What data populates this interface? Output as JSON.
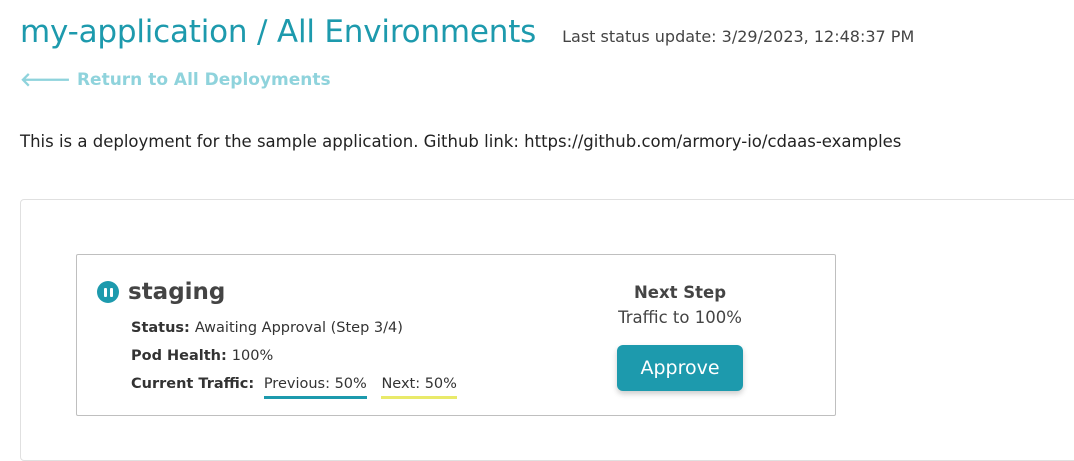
{
  "header": {
    "title": "my-application / All Environments",
    "last_update": "Last status update: 3/29/2023, 12:48:37 PM"
  },
  "back_link": {
    "arrow": "🡐",
    "label": "Return to All Deployments"
  },
  "description": "This is a deployment for the sample application. Github link: https://github.com/armory-io/cdaas-examples",
  "environment": {
    "name": "staging",
    "state_icon": "pause-icon",
    "status_label": "Status:",
    "status_value": "Awaiting Approval (Step 3/4)",
    "pod_health_label": "Pod Health:",
    "pod_health_value": "100%",
    "traffic_label": "Current Traffic:",
    "traffic_previous": "Previous: 50%",
    "traffic_next": "Next: 50%",
    "next_step_label": "Next Step",
    "next_step_value": "Traffic to 100%",
    "approve_label": "Approve"
  },
  "colors": {
    "accent": "#1d9aad",
    "link_light": "#8fd3dc",
    "next_traffic": "#e9ea6a"
  }
}
